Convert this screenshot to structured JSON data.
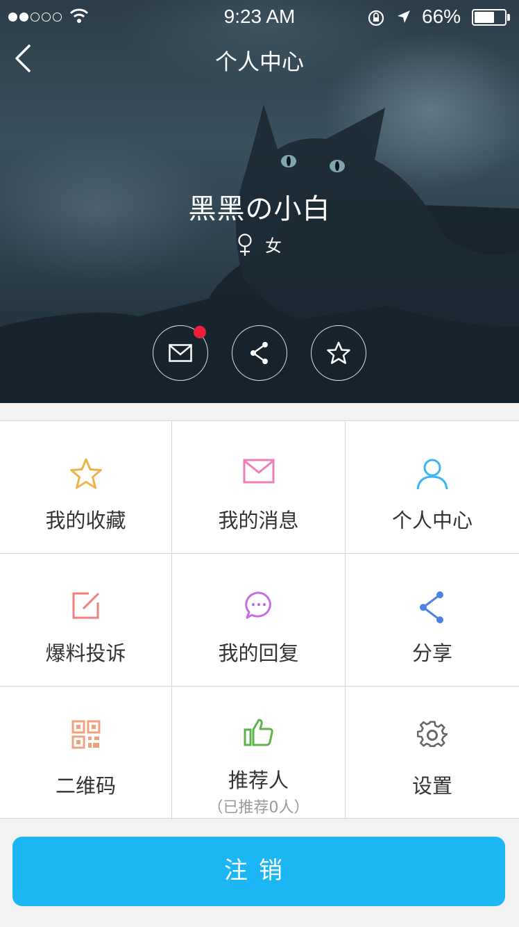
{
  "status_bar": {
    "time": "9:23 AM",
    "battery_percent": "66%",
    "battery_level": 0.66,
    "signal_bars_filled": 2,
    "signal_bars_total": 5
  },
  "nav": {
    "title": "个人中心",
    "back_icon": "chevron-left-icon"
  },
  "profile": {
    "name": "黑黑の小白",
    "gender_icon": "female-icon",
    "gender_label": "女"
  },
  "actions": [
    {
      "icon": "mail-icon",
      "has_badge": true
    },
    {
      "icon": "share-icon",
      "has_badge": false
    },
    {
      "icon": "star-icon",
      "has_badge": false
    }
  ],
  "menu": [
    {
      "label": "我的收藏",
      "icon": "star-icon",
      "color": "#f0b24a"
    },
    {
      "label": "我的消息",
      "icon": "mail-icon",
      "color": "#ef7fb9"
    },
    {
      "label": "个人中心",
      "icon": "user-icon",
      "color": "#3ab6f2"
    },
    {
      "label": "爆料投诉",
      "icon": "edit-icon",
      "color": "#f08080"
    },
    {
      "label": "我的回复",
      "icon": "chat-icon",
      "color": "#c86ee0"
    },
    {
      "label": "分享",
      "icon": "share-icon",
      "color": "#4a82e8"
    },
    {
      "label": "二维码",
      "icon": "qrcode-icon",
      "color": "#f0a07a"
    },
    {
      "label": "推荐人",
      "sublabel": "（已推荐0人）",
      "icon": "thumbs-up-icon",
      "color": "#5cb34a"
    },
    {
      "label": "设置",
      "icon": "gear-icon",
      "color": "#666666"
    }
  ],
  "logout": {
    "label": "注销",
    "color": "#1db6f5"
  }
}
